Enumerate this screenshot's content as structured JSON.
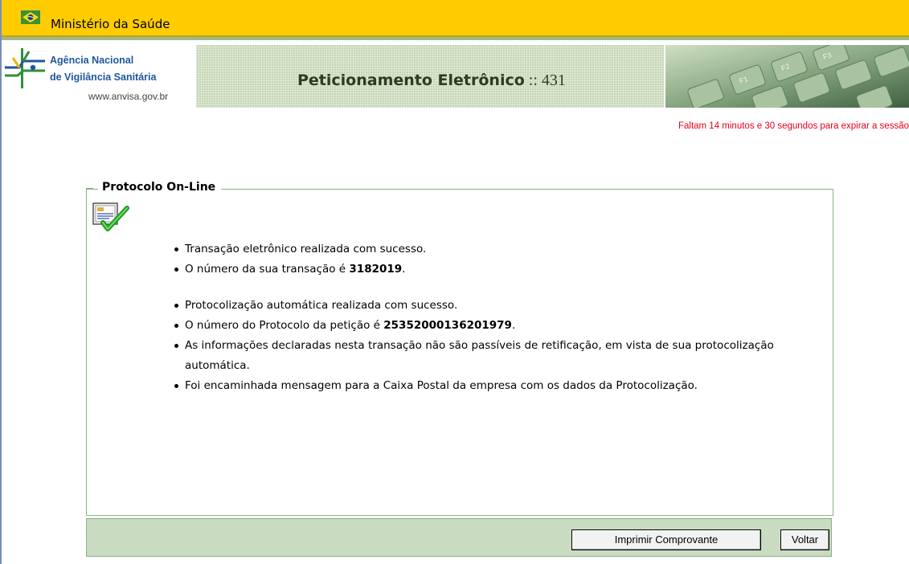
{
  "topbar": {
    "ministry": "Ministério da Saúde",
    "flag_icon": "brazil-flag-icon",
    "colors": {
      "background": "#ffcc00"
    }
  },
  "header": {
    "agency_line1": "Agência Nacional",
    "agency_line2": "de Vigilância Sanitária",
    "url": "www.anvisa.gov.br",
    "app_title": "Peticionamento Eletrônico",
    "app_separator": " :: ",
    "app_number": "431",
    "logo_icon": "anvisa-logo-icon",
    "colors": {
      "agency_text": "#1e56a0",
      "banner": "#c5d6b4"
    }
  },
  "session": {
    "timer_text": "Faltam 14 minutos e 30 segundos para expirar a sessão",
    "color": "#e8001c"
  },
  "panel": {
    "legend": "Protocolo On-Line",
    "icon": "certificate-check-icon",
    "messages": {
      "m1": "Transação eletrônico realizada com sucesso.",
      "m2_prefix": "O número da sua transação é ",
      "m2_value": "3182019",
      "m2_suffix": ".",
      "m3": "Protocolização automática realizada com sucesso.",
      "m4_prefix": "O número do Protocolo da petição é ",
      "m4_value": "25352000136201979",
      "m4_suffix": ".",
      "m5": "As informações declaradas nesta transação não são passíveis de retificação, em vista de sua protocolização automática.",
      "m6": "Foi encaminhada mensagem para a Caixa Postal da empresa com os dados da Protocolização."
    }
  },
  "footer": {
    "print_button": "Imprimir Comprovante",
    "back_button": "Voltar",
    "color": "#c9dbc0"
  }
}
